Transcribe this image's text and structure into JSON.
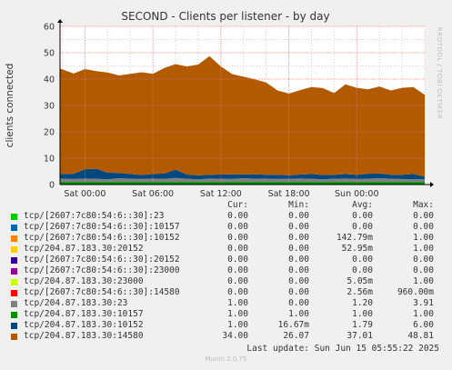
{
  "brand": "RRDTOOL / TOBI OETIKER",
  "footer": "Munin 2.0.75",
  "last_update": "Last update: Sun Jun 15 05:55:22 2025",
  "legend": {
    "headers": {
      "cur": "Cur:",
      "min": "Min:",
      "avg": "Avg:",
      "max": "Max:"
    },
    "rows": [
      {
        "name": "tcp/[2607:7c80:54:6::30]:23",
        "color": "#00cc00",
        "cur": "0.00",
        "min": "0.00",
        "avg": "0.00",
        "max": "0.00"
      },
      {
        "name": "tcp/[2607:7c80:54:6::30]:10157",
        "color": "#0066b3",
        "cur": "0.00",
        "min": "0.00",
        "avg": "0.00",
        "max": "0.00"
      },
      {
        "name": "tcp/[2607:7c80:54:6::30]:10152",
        "color": "#ff8000",
        "cur": "0.00",
        "min": "0.00",
        "avg": "142.79m",
        "max": "1.00"
      },
      {
        "name": "tcp/204.87.183.30:20152",
        "color": "#ffcc00",
        "cur": "0.00",
        "min": "0.00",
        "avg": "52.95m",
        "max": "1.00"
      },
      {
        "name": "tcp/[2607:7c80:54:6::30]:20152",
        "color": "#330099",
        "cur": "0.00",
        "min": "0.00",
        "avg": "0.00",
        "max": "0.00"
      },
      {
        "name": "tcp/[2607:7c80:54:6::30]:23000",
        "color": "#990099",
        "cur": "0.00",
        "min": "0.00",
        "avg": "0.00",
        "max": "0.00"
      },
      {
        "name": "tcp/204.87.183.30:23000",
        "color": "#ccff00",
        "cur": "0.00",
        "min": "0.00",
        "avg": "5.05m",
        "max": "1.00"
      },
      {
        "name": "tcp/[2607:7c80:54:6::30]:14580",
        "color": "#ff0000",
        "cur": "0.00",
        "min": "0.00",
        "avg": "2.56m",
        "max": "960.00m"
      },
      {
        "name": "tcp/204.87.183.30:23",
        "color": "#808080",
        "cur": "1.00",
        "min": "0.00",
        "avg": "1.20",
        "max": "3.91"
      },
      {
        "name": "tcp/204.87.183.30:10157",
        "color": "#008f00",
        "cur": "1.00",
        "min": "1.00",
        "avg": "1.00",
        "max": "1.00"
      },
      {
        "name": "tcp/204.87.183.30:10152",
        "color": "#00487d",
        "cur": "1.00",
        "min": "16.67m",
        "avg": "1.79",
        "max": "6.00"
      },
      {
        "name": "tcp/204.87.183.30:14580",
        "color": "#b35a00",
        "cur": "34.00",
        "min": "26.07",
        "avg": "37.01",
        "max": "48.81"
      }
    ]
  },
  "chart_data": {
    "type": "area",
    "title": "SECOND - Clients per listener - by day",
    "ylabel": "clients connected",
    "xlabel": "",
    "ylim": [
      0,
      60
    ],
    "yticks": [
      "0",
      "10",
      "20",
      "30",
      "40",
      "50",
      "60"
    ],
    "xtick_labels": [
      "Sat 00:00",
      "Sat 06:00",
      "Sat 12:00",
      "Sat 18:00",
      "Sun 00:00"
    ],
    "x_hours_from_start": [
      0,
      6,
      12,
      18,
      24
    ],
    "x_range_hours": [
      -2.2,
      30
    ],
    "grid": true,
    "stacked": true,
    "x": [
      -2.2,
      -1,
      0,
      1,
      2,
      3,
      4,
      5,
      6,
      7,
      8,
      9,
      10,
      11,
      12,
      13,
      14,
      15,
      16,
      17,
      18,
      19,
      20,
      21,
      22,
      23,
      24,
      25,
      26,
      27,
      28,
      29,
      30
    ],
    "series": [
      {
        "name": "tcp/204.87.183.30:10157",
        "color": "#008f00",
        "values": [
          1,
          1,
          1,
          1,
          1,
          1,
          1,
          1,
          1,
          1,
          1,
          1,
          1,
          1,
          1,
          1,
          1,
          1,
          1,
          1,
          1,
          1,
          1,
          1,
          1,
          1,
          1,
          1,
          1,
          1,
          1,
          1,
          1
        ]
      },
      {
        "name": "tcp/204.87.183.30:23",
        "color": "#808080",
        "values": [
          1.2,
          1.1,
          1.3,
          1.2,
          1.0,
          1.4,
          1.2,
          1.1,
          1.3,
          1.2,
          1.5,
          1.2,
          1.0,
          1.3,
          1.2,
          1.1,
          1.4,
          1.2,
          1.3,
          1.1,
          1.2,
          1.3,
          1.2,
          1.0,
          1.2,
          1.3,
          1.1,
          1.2,
          1.4,
          1.2,
          1.1,
          1.0,
          1.0
        ]
      },
      {
        "name": "tcp/204.87.183.30:10152",
        "color": "#00487d",
        "values": [
          1.8,
          2.0,
          3.5,
          3.8,
          2.5,
          2.0,
          1.8,
          1.5,
          1.7,
          2.0,
          3.2,
          1.6,
          1.5,
          1.4,
          1.6,
          1.8,
          1.5,
          1.7,
          1.4,
          1.6,
          1.3,
          1.5,
          1.8,
          1.6,
          1.5,
          1.7,
          1.6,
          1.9,
          1.8,
          1.5,
          1.6,
          2.0,
          1.0
        ]
      },
      {
        "name": "tcp/204.87.183.30:14580",
        "color": "#b35a00",
        "values": [
          40,
          38,
          38,
          37,
          38,
          37,
          38,
          39,
          38,
          40,
          40,
          41,
          42,
          45,
          41,
          38,
          37,
          36,
          35,
          32,
          31,
          32,
          33,
          33,
          31,
          34,
          33,
          32,
          33,
          32,
          33,
          33,
          31
        ]
      }
    ]
  }
}
